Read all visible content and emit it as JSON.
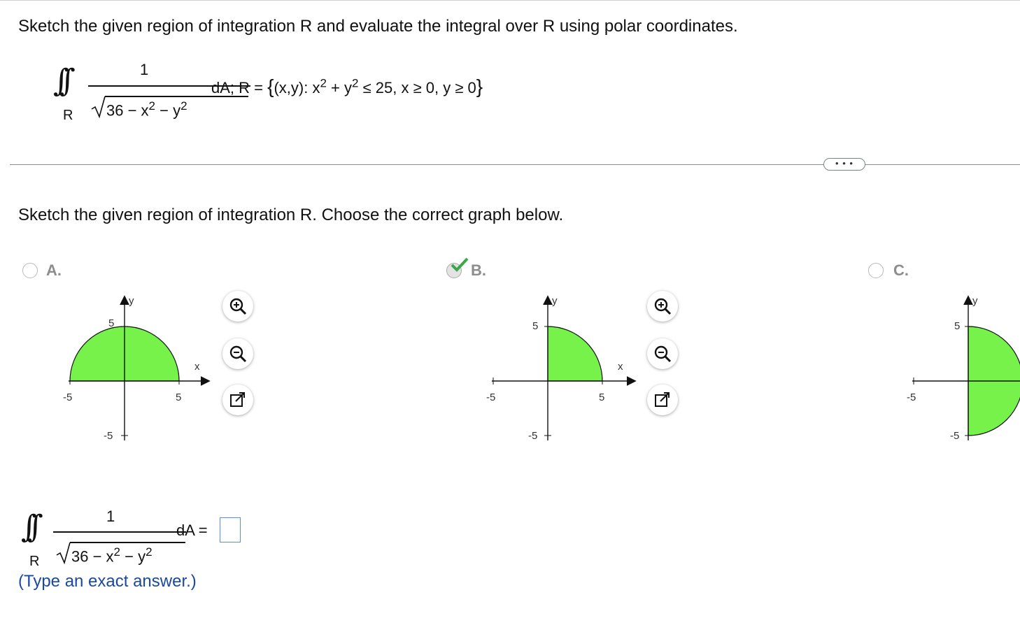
{
  "question": {
    "prompt": "Sketch the given region of integration R and evaluate the integral over R using polar coordinates.",
    "integrand_numerator": "1",
    "integrand_radicand": "36 − x",
    "radicand_minus_y": " − y",
    "exponent": "2",
    "region_label": "R",
    "region_prefix": "dA; R =",
    "region_set_open": "(x,y): x",
    "region_plus": " + y",
    "region_rest": " ≤ 25, x ≥ 0, y ≥ 0"
  },
  "more_button_label": "• • •",
  "sub_question": "Sketch the given region of integration R. Choose the correct graph below.",
  "options": [
    {
      "letter": "A.",
      "selected": false
    },
    {
      "letter": "B.",
      "selected": true
    },
    {
      "letter": "C.",
      "selected": false
    }
  ],
  "graph_labels": {
    "x_axis": "x",
    "y_axis": "y",
    "pos_tick": "5",
    "neg_tick": "-5"
  },
  "tools": [
    "zoom-in",
    "zoom-out",
    "open-new-window"
  ],
  "answer": {
    "numerator": "1",
    "radicand": "36 − x",
    "minus_y": " − y",
    "exponent": "2",
    "region_label": "R",
    "suffix": "dA =",
    "value": "",
    "hint": "(Type an exact answer.)"
  },
  "colors": {
    "region_fill": "#77f24a",
    "check": "#3aa84a",
    "hint_blue": "#1a4aa0"
  }
}
